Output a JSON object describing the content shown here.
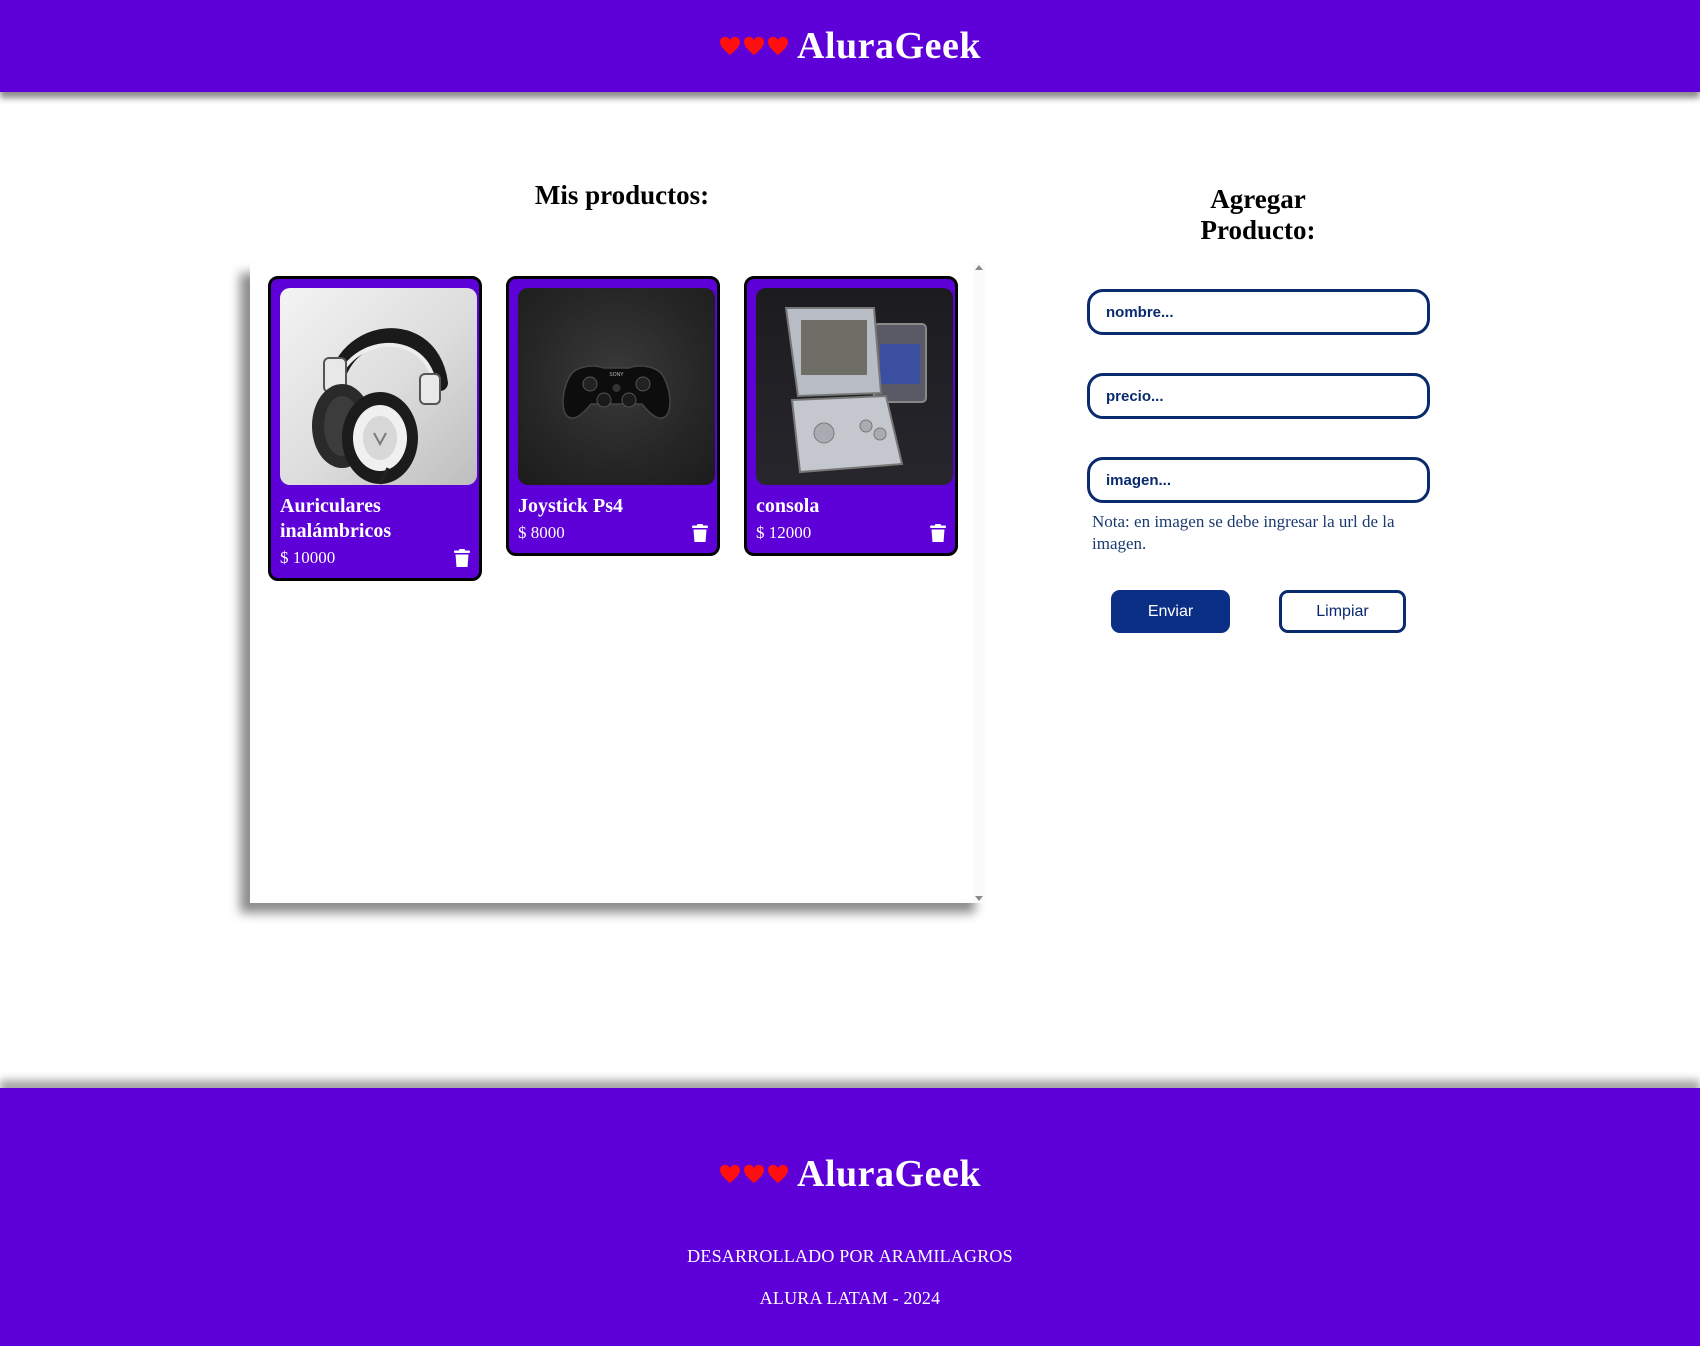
{
  "header": {
    "brand": "AluraGeek",
    "heart_color": "#ff0000",
    "bar_color": "#5e00d8"
  },
  "products": {
    "title": "Mis productos:",
    "items": [
      {
        "name": "Auriculares inalámbricos",
        "price": "$ 10000",
        "image": "headphones-image"
      },
      {
        "name": "Joystick Ps4",
        "price": "$ 8000",
        "image": "ps4-controller-image"
      },
      {
        "name": "consola",
        "price": "$ 12000",
        "image": "gameboy-advance-sp-image"
      }
    ]
  },
  "form": {
    "title": "Agregar Producto:",
    "fields": {
      "name_placeholder": "nombre...",
      "price_placeholder": "precio...",
      "image_placeholder": "imagen..."
    },
    "note": "Nota: en imagen se debe ingresar la url de la imagen.",
    "submit_label": "Enviar",
    "clear_label": "Limpiar",
    "accent_color": "#0a2a6e"
  },
  "footer": {
    "brand": "AluraGeek",
    "developed_by": "DESARROLLADO POR ARAMILAGROS",
    "copyright": "ALURA LATAM - 2024"
  }
}
